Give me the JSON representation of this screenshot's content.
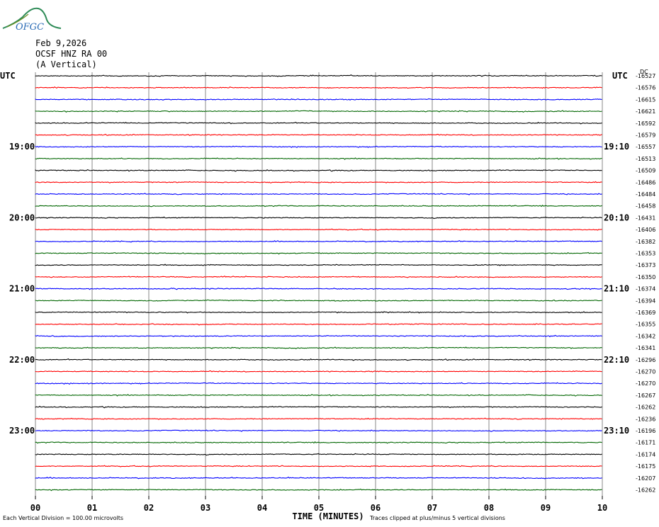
{
  "logo": {
    "text": "OFGC"
  },
  "header": {
    "date": "Feb 9,2026",
    "station": "OCSF HNZ RA 00",
    "component": "(A Vertical)"
  },
  "chart_data": {
    "type": "line",
    "xlabel": "TIME (MINUTES)",
    "x_ticks": [
      "00",
      "01",
      "02",
      "03",
      "04",
      "05",
      "06",
      "07",
      "08",
      "09",
      "10"
    ],
    "xlim": [
      0,
      10
    ],
    "left_axis_label": "UTC",
    "right_axis_label": "UTC",
    "dc_label": "DC",
    "left_time_labels": [
      {
        "row": 6,
        "label": "19:00"
      },
      {
        "row": 12,
        "label": "20:00"
      },
      {
        "row": 18,
        "label": "21:00"
      },
      {
        "row": 24,
        "label": "22:00"
      },
      {
        "row": 30,
        "label": "23:00"
      }
    ],
    "right_time_labels": [
      {
        "row": 6,
        "label": "19:10"
      },
      {
        "row": 12,
        "label": "20:10"
      },
      {
        "row": 18,
        "label": "21:10"
      },
      {
        "row": 24,
        "label": "22:10"
      },
      {
        "row": 30,
        "label": "23:10"
      }
    ],
    "trace_colors": [
      "#000000",
      "#ff0000",
      "#0000ff",
      "#006600"
    ],
    "dc_offsets": [
      -16527,
      -16576,
      -16615,
      -16621,
      -16592,
      -16579,
      -16557,
      -16513,
      -16509,
      -16486,
      -16484,
      -16458,
      -16431,
      -16406,
      -16382,
      -16353,
      -16373,
      -16350,
      -16374,
      -16394,
      -16369,
      -16355,
      -16342,
      -16341,
      -16296,
      -16270,
      -16270,
      -16267,
      -16262,
      -16236,
      -16196,
      -16171,
      -16174,
      -16175,
      -16207,
      -16262
    ],
    "footer_left": "Each Vertical Division =  100.00 microvolts",
    "footer_right": "Traces clipped at plus/minus 5 vertical divisions"
  }
}
